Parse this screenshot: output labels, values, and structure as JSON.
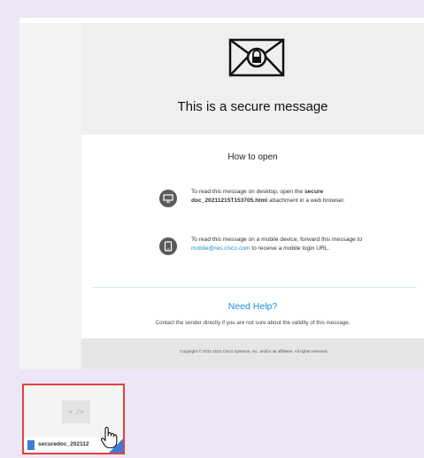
{
  "message": {
    "title": "This is a secure message",
    "how_to_open": "How to open",
    "desktop_step": {
      "prefix": "To read this message on desktop, open the ",
      "file": "secure doc_20211215T153705.html",
      "suffix": " attachment in a web browser."
    },
    "mobile_step": {
      "prefix": "To read this message on a mobile device, forward this message to ",
      "email": "mobile@res.cisco.com",
      "suffix": " to receive a mobile login URL."
    },
    "need_help": "Need Help?",
    "contact": "Contact the sender directly if you are not sure about the validity of this message.",
    "copyright": "Copyright © 2011-2021 Cisco Systems, Inc. and/or its affiliates. All rights reserved."
  },
  "attachment": {
    "preview_glyph": "< />",
    "name": "securedoc_202112"
  },
  "colors": {
    "accent": "#1a8fd8",
    "highlight_border": "#e0443e",
    "file_icon": "#3c7bd8"
  }
}
